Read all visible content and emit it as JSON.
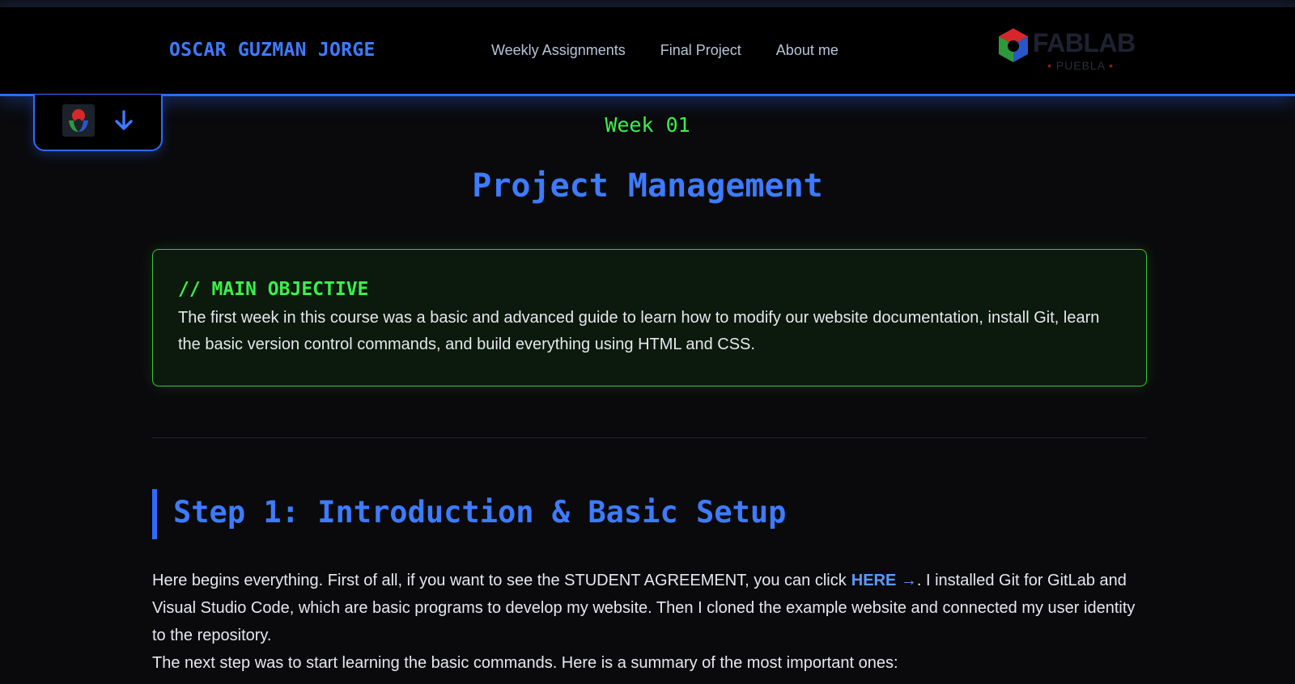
{
  "header": {
    "brand": "OSCAR GUZMAN JORGE",
    "nav": [
      "Weekly Assignments",
      "Final Project",
      "About me"
    ],
    "logo": {
      "word": "FABLAB",
      "sub": "PUEBLA",
      "icon": "fablab-cube-icon"
    }
  },
  "tab": {
    "logo_icon": "fablab-logo-icon",
    "arrow_icon": "arrow-down-icon"
  },
  "page": {
    "week_label": "Week 01",
    "title": "Project Management"
  },
  "objective": {
    "heading": "// MAIN OBJECTIVE",
    "text": "The first week in this course was a basic and advanced guide to learn how to modify our website documentation, install Git, learn the basic version control commands, and build everything using HTML and CSS."
  },
  "step1": {
    "title": "Step 1: Introduction & Basic Setup",
    "para1_before": "Here begins everything. First of all, if you want to see the STUDENT AGREEMENT, you can click",
    "link_text": "HERE →",
    "para1_after": ". I installed Git for GitLab and Visual Studio Code, which are basic programs to develop my website. Then I cloned the example website and connected my user identity to the repository.",
    "para2": "The next step was to start learning the basic commands. Here is a summary of the most important ones:"
  },
  "colors": {
    "accent_blue": "#2f6bff",
    "accent_green": "#3cf04a",
    "background": "#0a0a0c"
  }
}
